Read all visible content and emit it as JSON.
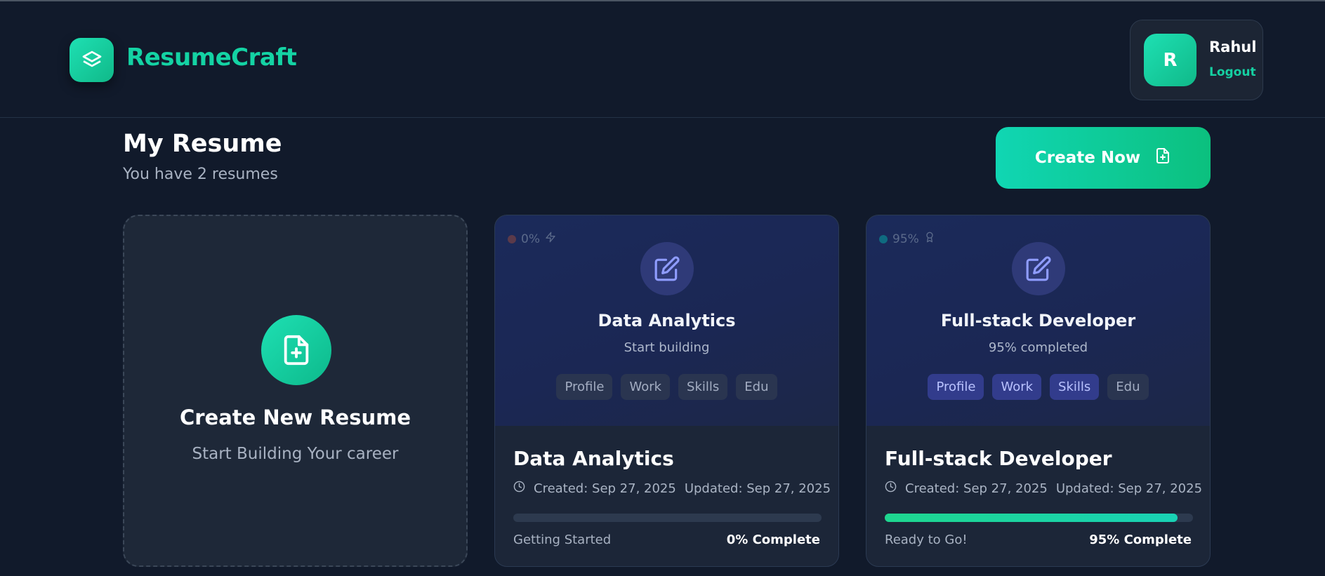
{
  "app": {
    "name": "ResumeCraft",
    "logo_icon": "layers-icon",
    "accent_color": "#14d3a4"
  },
  "user": {
    "initial": "R",
    "name": "Rahul",
    "logout_label": "Logout"
  },
  "page": {
    "title": "My Resume",
    "subtitle": "You have 2 resumes",
    "create_button_label": "Create Now",
    "create_button_icon": "file-plus-icon"
  },
  "new_resume_card": {
    "title": "Create New Resume",
    "subtitle": "Start Building Your career",
    "icon": "file-plus-icon"
  },
  "resumes": [
    {
      "percent_label": "0%",
      "dot_color": "#5b3a4a",
      "badge_icon": "zap-icon",
      "name": "Data Analytics",
      "status": "Start building",
      "chips": [
        {
          "label": "Profile",
          "active": false
        },
        {
          "label": "Work",
          "active": false
        },
        {
          "label": "Skills",
          "active": false
        },
        {
          "label": "Edu",
          "active": false
        }
      ],
      "title": "Data Analytics",
      "created": "Created: Sep 27, 2025",
      "updated": "Updated: Sep 27, 2025",
      "progress": 0,
      "progress_label": "Getting Started",
      "complete_label": "0% Complete"
    },
    {
      "percent_label": "95%",
      "dot_color": "#0f6b80",
      "badge_icon": "award-icon",
      "name": "Full-stack Developer",
      "status": "95% completed",
      "chips": [
        {
          "label": "Profile",
          "active": true
        },
        {
          "label": "Work",
          "active": true
        },
        {
          "label": "Skills",
          "active": true
        },
        {
          "label": "Edu",
          "active": false
        }
      ],
      "title": "Full-stack Developer",
      "created": "Created: Sep 27, 2025",
      "updated": "Updated: Sep 27, 2025",
      "progress": 95,
      "progress_label": "Ready to Go!",
      "complete_label": "95% Complete"
    }
  ]
}
